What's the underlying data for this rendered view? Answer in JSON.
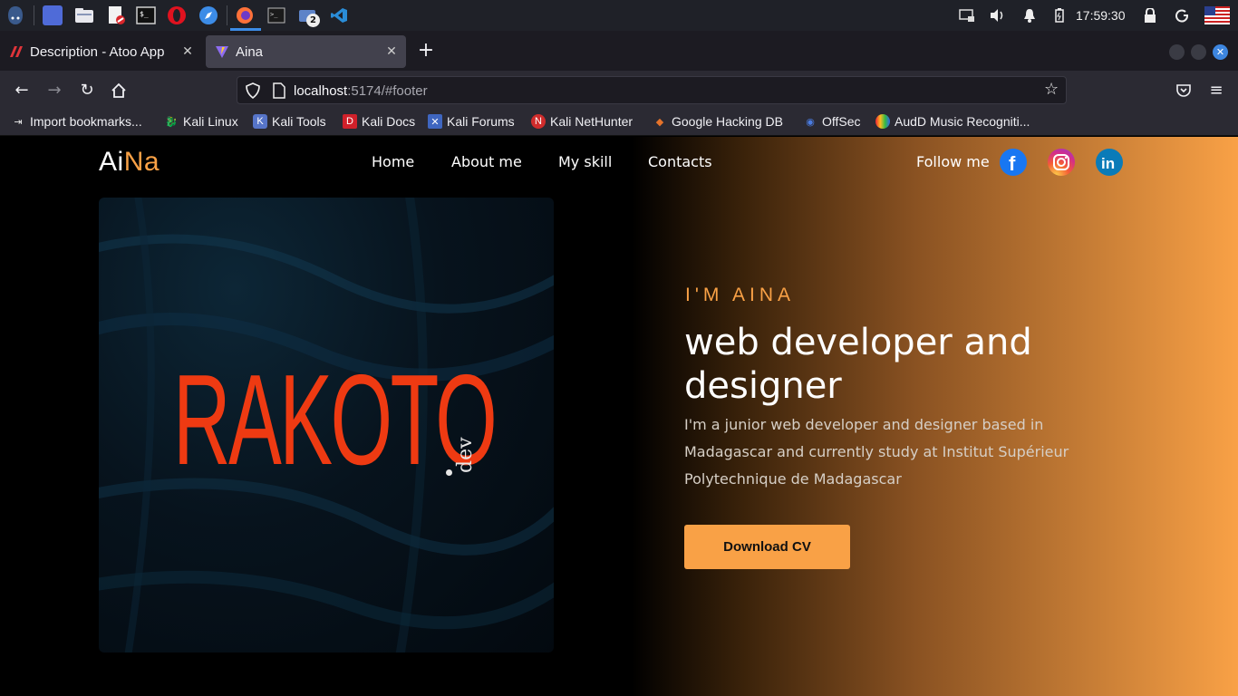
{
  "taskbar": {
    "clock": "17:59:30",
    "badge_count": "2",
    "icons": [
      "kali-menu-icon",
      "workspace-icon",
      "file-manager-icon",
      "text-editor-icon",
      "terminal-icon",
      "opera-icon",
      "web-browser-icon",
      "firefox-icon",
      "terminal-window-icon",
      "files-window-icon",
      "vscode-icon"
    ],
    "tray_icons": [
      "screen-cast-icon",
      "volume-icon",
      "notification-bell-icon",
      "battery-icon",
      "lock-icon",
      "power-icon",
      "flag-us-icon"
    ]
  },
  "browser": {
    "tabs": [
      {
        "title": "Description - Atoo App",
        "active": false
      },
      {
        "title": "Aina",
        "active": true
      }
    ],
    "url_host": "localhost",
    "url_rest": ":5174/#footer",
    "bookmarks": [
      "Import bookmarks...",
      "Kali Linux",
      "Kali Tools",
      "Kali Docs",
      "Kali Forums",
      "Kali NetHunter",
      "Google Hacking DB",
      "OffSec",
      "AudD Music Recogniti..."
    ]
  },
  "site": {
    "logo_main": "Ai",
    "logo_accent": "Na",
    "menu": [
      "Home",
      "About me",
      "My skill",
      "Contacts"
    ],
    "follow_label": "Follow me",
    "social": [
      "facebook-icon",
      "instagram-icon",
      "linkedin-icon"
    ],
    "image_brand": "RAKOTO",
    "image_suffix": "dev",
    "intro": "I'M AINA",
    "headline": "web developer and designer",
    "description": "I'm a junior web developer and designer based in Madagascar and currently study at Institut Supérieur Polytechnique de Madagascar",
    "cta": "Download CV"
  },
  "colors": {
    "accent": "#f9a146",
    "brand_red": "#ee3a12",
    "taskbar_bg": "#1f2128",
    "browser_bg": "#2b2a33"
  }
}
